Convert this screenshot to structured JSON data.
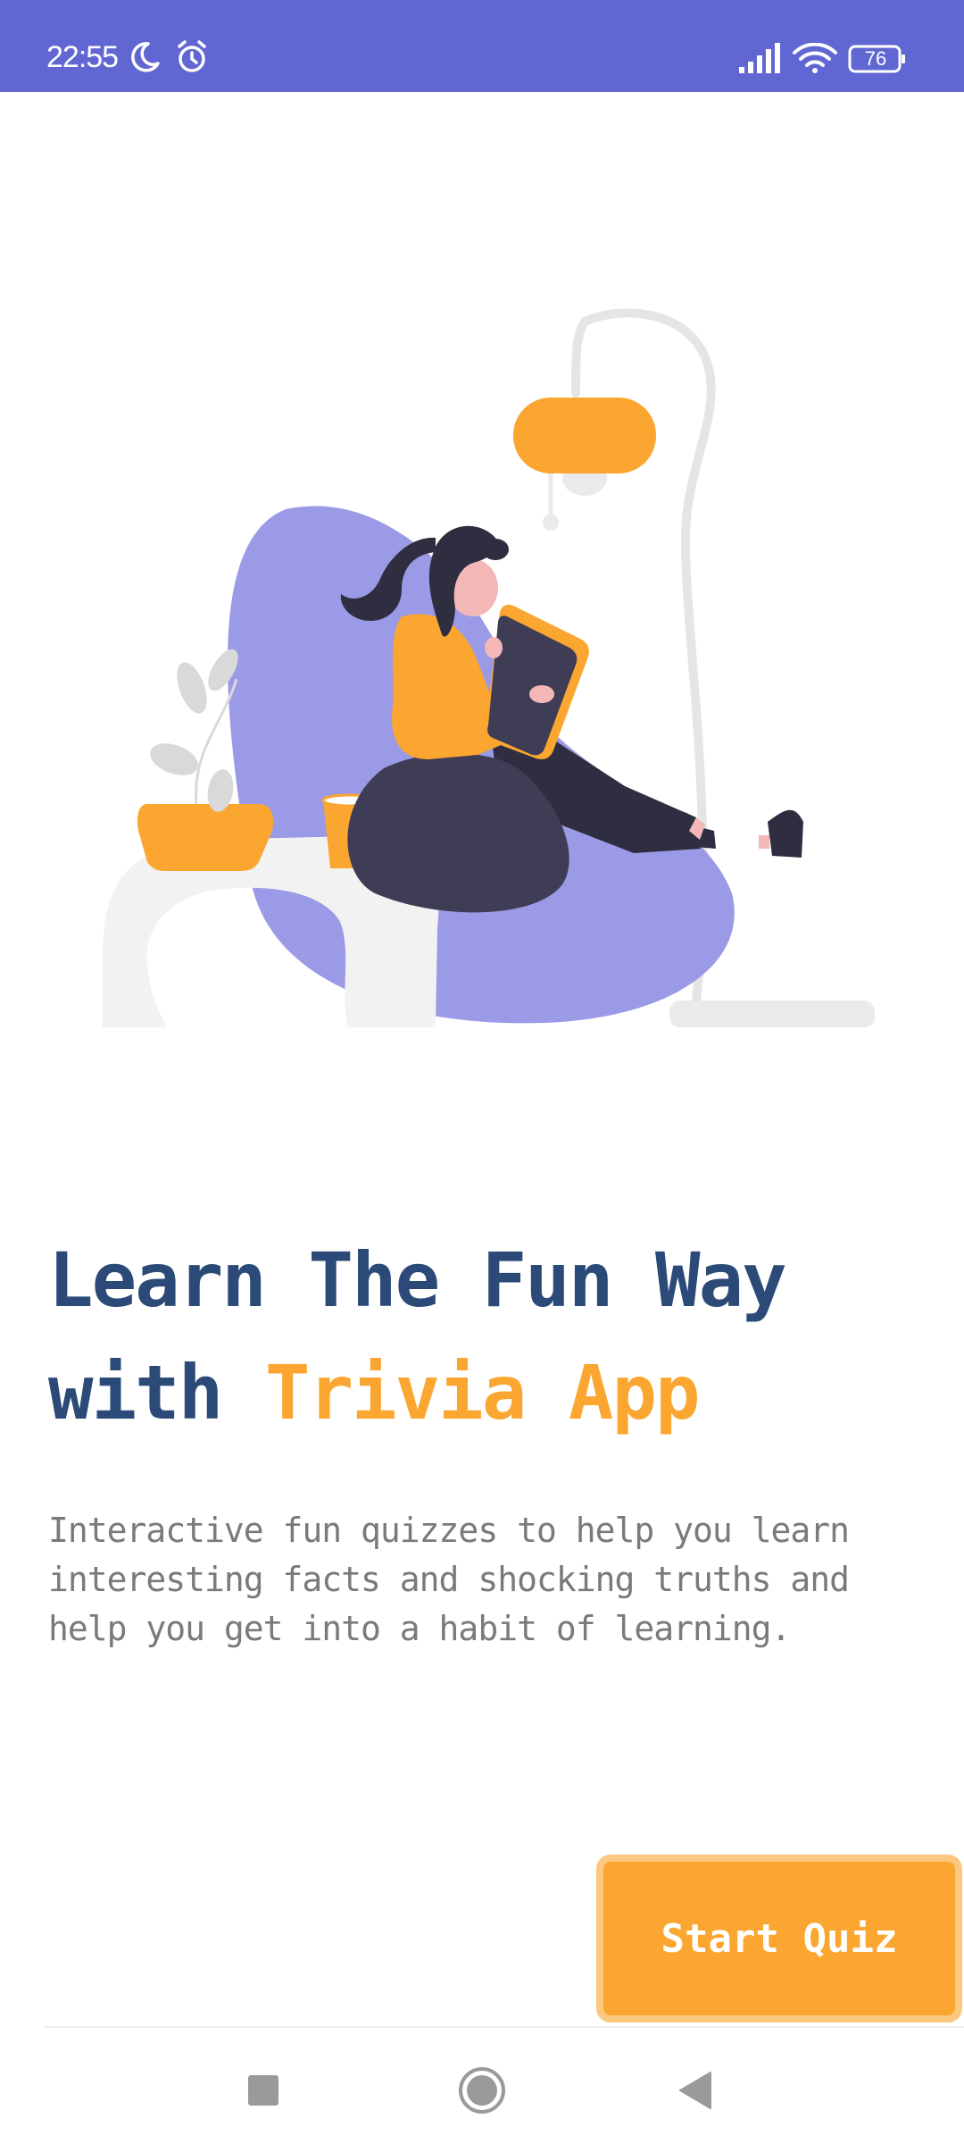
{
  "status_bar": {
    "time": "22:55",
    "battery": "76",
    "background": "#6067D2",
    "icons": [
      "moon-icon",
      "alarm-icon",
      "signal-icon",
      "wifi-icon",
      "battery-icon"
    ]
  },
  "onboarding": {
    "title_line1": "Learn The Fun Way",
    "title_with": "with ",
    "title_app": "Trivia App",
    "description": "Interactive fun quizzes to help you learn interesting facts and shocking truths and help you get into a habit of learning.",
    "start_button": "Start Quiz"
  },
  "colors": {
    "primary": "#2C4A78",
    "accent": "#FAA630",
    "illustration_chair": "#9A9AE6",
    "text_muted": "#7a7a7a"
  },
  "navigation": {
    "buttons": [
      "recent-apps-button",
      "home-button",
      "back-button"
    ]
  }
}
